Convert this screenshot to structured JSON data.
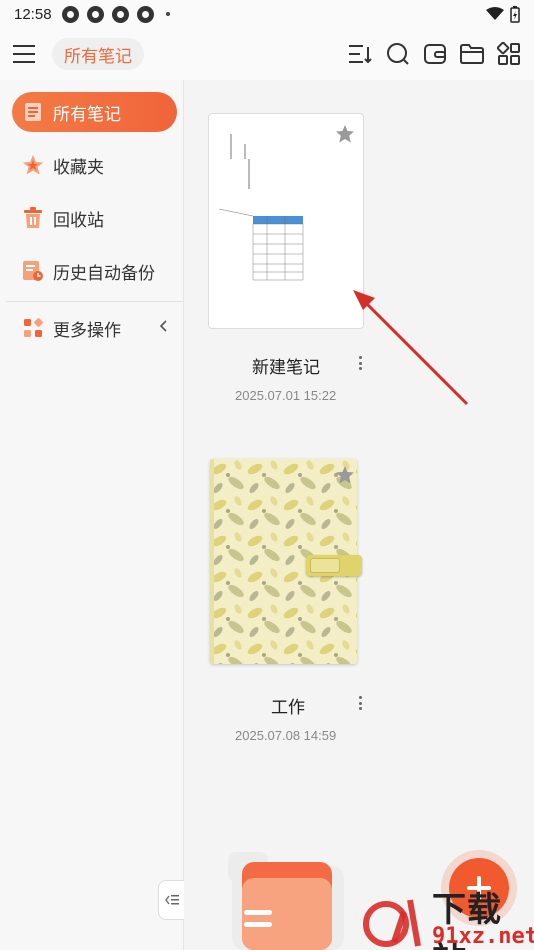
{
  "status": {
    "time": "12:58"
  },
  "header": {
    "title": "所有笔记"
  },
  "toolbar_icons": [
    "sort-icon",
    "search-icon",
    "wallet-icon",
    "folder-icon",
    "grid-icon"
  ],
  "sidebar": {
    "items": [
      {
        "label": "所有笔记",
        "icon": "notes-icon",
        "active": true
      },
      {
        "label": "收藏夹",
        "icon": "star-icon"
      },
      {
        "label": "回收站",
        "icon": "trash-icon"
      },
      {
        "label": "历史自动备份",
        "icon": "backup-icon"
      }
    ],
    "more": {
      "label": "更多操作",
      "icon": "more-ops-icon"
    }
  },
  "notes": [
    {
      "title": "新建笔记",
      "date": "2025.07.01 15:22"
    },
    {
      "title": "工作",
      "date": "2025.07.08 14:59"
    }
  ],
  "watermark": {
    "text_main": "下载站",
    "text_url": "91xz.net"
  },
  "colors": {
    "accent": "#f0643a",
    "fab": "#f05a2e"
  }
}
